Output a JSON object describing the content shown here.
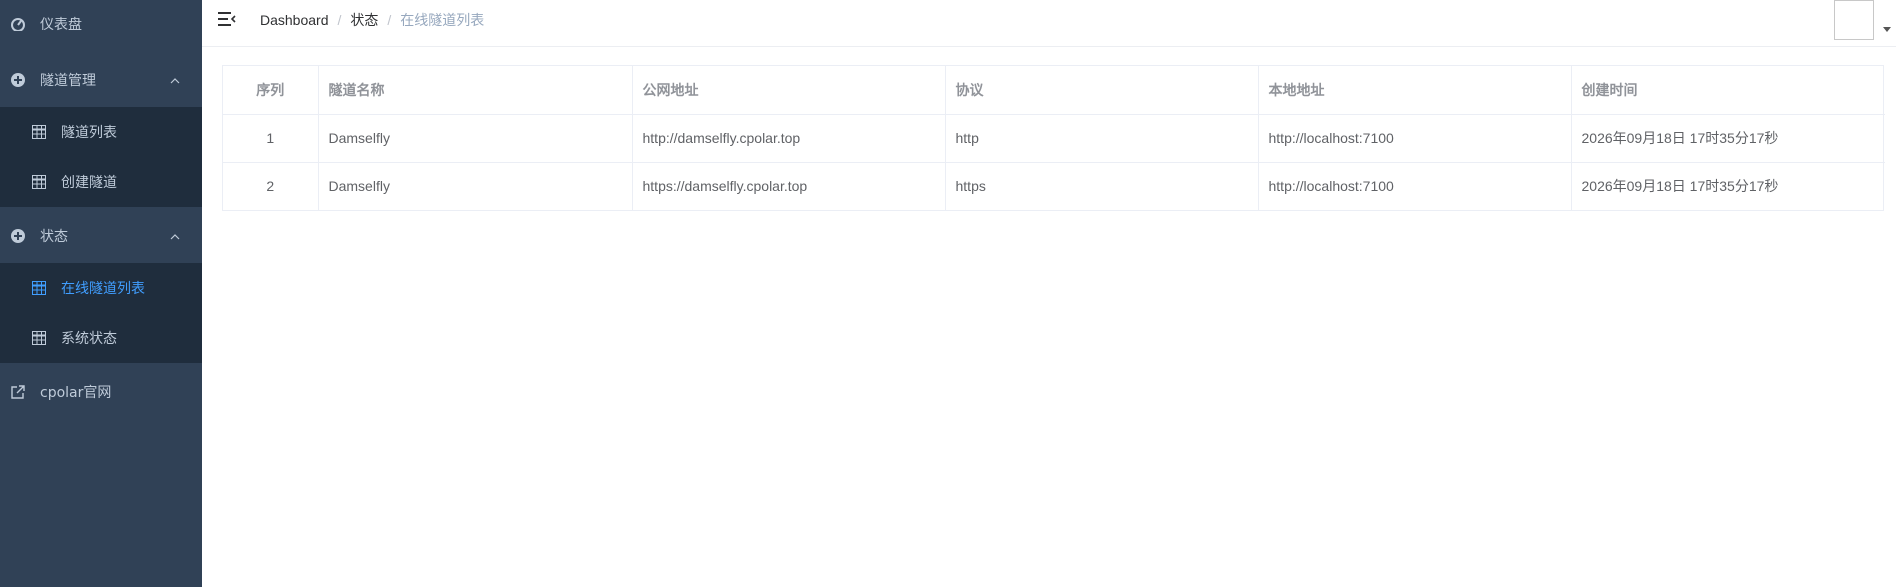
{
  "sidebar": {
    "dashboard": "仪表盘",
    "tunnel_mgmt": "隧道管理",
    "tunnel_list": "隧道列表",
    "create_tunnel": "创建隧道",
    "status": "状态",
    "online_tunnels": "在线隧道列表",
    "system_status": "系统状态",
    "cpolar_site": "cpolar官网"
  },
  "header": {
    "breadcrumb": [
      "Dashboard",
      "状态",
      "在线隧道列表"
    ]
  },
  "table": {
    "columns": [
      "序列",
      "隧道名称",
      "公网地址",
      "协议",
      "本地地址",
      "创建时间"
    ],
    "rows": [
      [
        "1",
        "Damselfly",
        "http://damselfly.cpolar.top",
        "http",
        "http://localhost:7100",
        "2026年09月18日 17时35分17秒"
      ],
      [
        "2",
        "Damselfly",
        "https://damselfly.cpolar.top",
        "https",
        "http://localhost:7100",
        "2026年09月18日 17时35分17秒"
      ]
    ]
  },
  "colors": {
    "sidebar_bg": "#304156",
    "submenu_bg": "#1f2d3d",
    "active": "#409eff"
  }
}
